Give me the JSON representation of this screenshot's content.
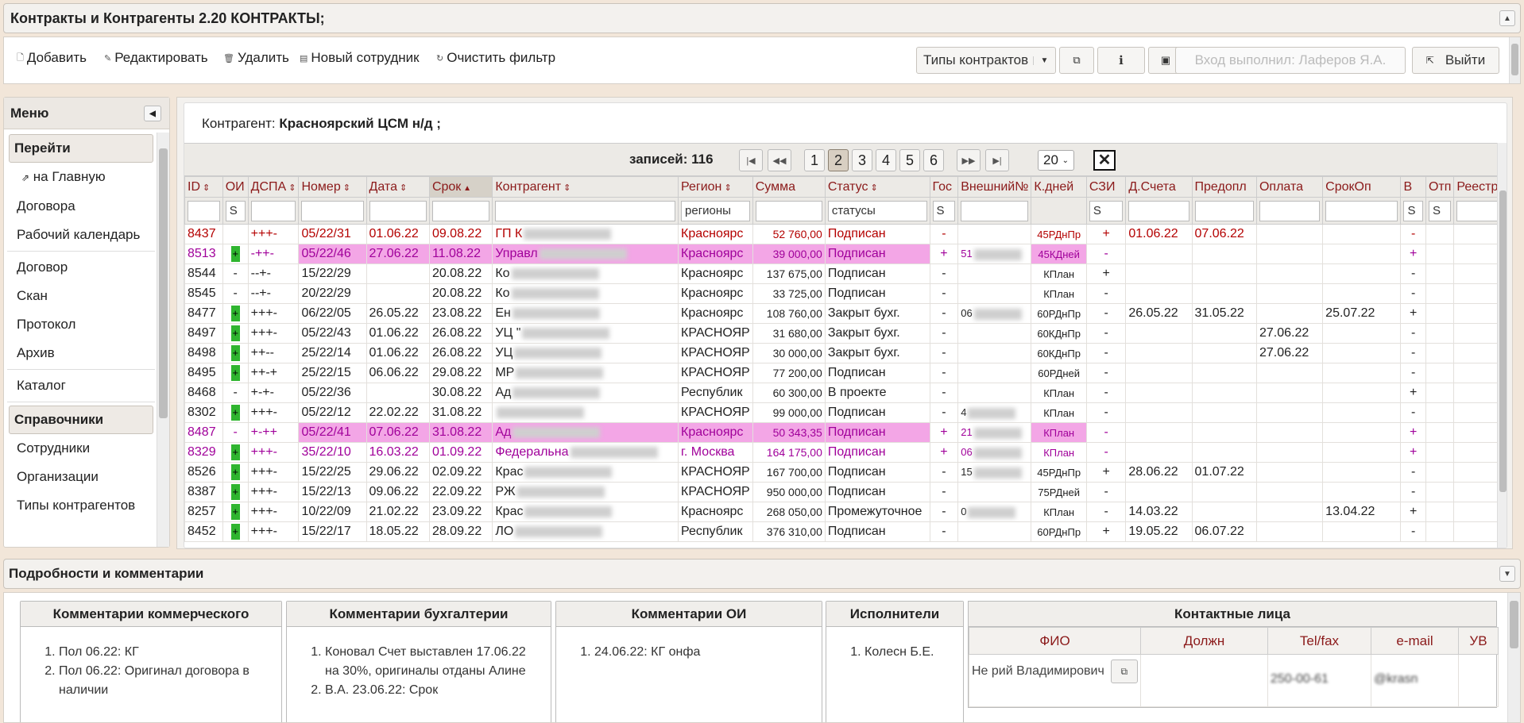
{
  "app": {
    "title": "Контракты и Контрагенты 2.20 КОНТРАКТЫ;"
  },
  "toolbar": {
    "add": "Добавить",
    "edit": "Редактировать",
    "delete": "Удалить",
    "new_employee": "Новый сотрудник",
    "clear_filter": "Очистить фильтр",
    "contract_types": "Типы контрактов",
    "logged_in": "Вход выполнил: Лаферов Я.А.",
    "logout": "Выйти"
  },
  "sidebar": {
    "title": "Меню",
    "go_section": "Перейти",
    "home": "на Главную",
    "items1": [
      "Договора",
      "Рабочий календарь"
    ],
    "items2": [
      "Договор",
      "Скан",
      "Протокол",
      "Архив"
    ],
    "catalog": "Каталог",
    "ref_section": "Справочники",
    "items3": [
      "Сотрудники",
      "Организации",
      "Типы контрагентов"
    ]
  },
  "main": {
    "kontragent_label": "Контрагент:",
    "kontragent_value": "Красноярский ЦСМ н/д ;",
    "pager": {
      "count_label": "записей: 116",
      "pages": [
        "1",
        "2",
        "3",
        "4",
        "5",
        "6"
      ],
      "active": "2",
      "page_size": "20"
    },
    "columns": [
      "ID",
      "ОИ",
      "ДСПА",
      "Номер",
      "Дата",
      "Срок",
      "Контрагент",
      "Регион",
      "Сумма",
      "Статус",
      "Гос",
      "Внешний№",
      "К.дней",
      "СЗИ",
      "Д.Счета",
      "Предопл",
      "Оплата",
      "СрокОп",
      "В",
      "Отп",
      "Реестр"
    ],
    "filters": {
      "oi": "S",
      "region": "регионы",
      "status": "статусы",
      "gos": "S",
      "szi": "S",
      "v": "S",
      "otp": "S"
    },
    "rows": [
      {
        "id": "8437",
        "oi": "",
        "dspa": "+++-",
        "num": "05/22/31",
        "date": "01.06.22",
        "srok": "09.08.22",
        "kontr": "ГП К",
        "region": "Красноярс",
        "sum": "52 760,00",
        "status": "Подписан",
        "gos": "-",
        "ext": "",
        "kdn": "45РДнПр",
        "szi": "+",
        "dschet": "01.06.22",
        "predopl": "07.06.22",
        "opl": "",
        "srokop": "",
        "v": "-",
        "cls": "red"
      },
      {
        "id": "8513",
        "oi": "+",
        "dspa": "-++-",
        "num": "05/22/46",
        "date": "27.06.22",
        "srok": "11.08.22",
        "kontr": "Управл",
        "region": "Красноярс",
        "sum": "39 000,00",
        "status": "Подписан",
        "gos": "+",
        "ext": "51",
        "kdn": "45КДней",
        "szi": "-",
        "dschet": "",
        "predopl": "",
        "opl": "",
        "srokop": "",
        "v": "+",
        "cls": "pink"
      },
      {
        "id": "8544",
        "oi": "-",
        "dspa": "--+-",
        "num": "15/22/29",
        "date": "",
        "srok": "20.08.22",
        "kontr": "Ко",
        "region": "Красноярс",
        "sum": "137 675,00",
        "status": "Подписан",
        "gos": "-",
        "ext": "",
        "kdn": "КПлан",
        "szi": "+",
        "dschet": "",
        "predopl": "",
        "opl": "",
        "srokop": "",
        "v": "-",
        "cls": ""
      },
      {
        "id": "8545",
        "oi": "-",
        "dspa": "--+-",
        "num": "20/22/29",
        "date": "",
        "srok": "20.08.22",
        "kontr": "Ко",
        "region": "Красноярс",
        "sum": "33 725,00",
        "status": "Подписан",
        "gos": "-",
        "ext": "",
        "kdn": "КПлан",
        "szi": "-",
        "dschet": "",
        "predopl": "",
        "opl": "",
        "srokop": "",
        "v": "-",
        "cls": ""
      },
      {
        "id": "8477",
        "oi": "+",
        "dspa": "+++-",
        "num": "06/22/05",
        "date": "26.05.22",
        "srok": "23.08.22",
        "kontr": "Ен",
        "region": "Красноярс",
        "sum": "108 760,00",
        "status": "Закрыт бухг.",
        "gos": "-",
        "ext": "06",
        "kdn": "60РДнПр",
        "szi": "-",
        "dschet": "26.05.22",
        "predopl": "31.05.22",
        "opl": "",
        "srokop": "25.07.22",
        "v": "+",
        "cls": ""
      },
      {
        "id": "8497",
        "oi": "+",
        "dspa": "+++-",
        "num": "05/22/43",
        "date": "01.06.22",
        "srok": "26.08.22",
        "kontr": "УЦ \"",
        "region": "КРАСНОЯР",
        "sum": "31 680,00",
        "status": "Закрыт бухг.",
        "gos": "-",
        "ext": "",
        "kdn": "60КДнПр",
        "szi": "-",
        "dschet": "",
        "predopl": "",
        "opl": "27.06.22",
        "srokop": "",
        "v": "-",
        "cls": ""
      },
      {
        "id": "8498",
        "oi": "+",
        "dspa": "++--",
        "num": "25/22/14",
        "date": "01.06.22",
        "srok": "26.08.22",
        "kontr": "УЦ",
        "region": "КРАСНОЯР",
        "sum": "30 000,00",
        "status": "Закрыт бухг.",
        "gos": "-",
        "ext": "",
        "kdn": "60КДнПр",
        "szi": "-",
        "dschet": "",
        "predopl": "",
        "opl": "27.06.22",
        "srokop": "",
        "v": "-",
        "cls": ""
      },
      {
        "id": "8495",
        "oi": "+",
        "dspa": "++-+",
        "num": "25/22/15",
        "date": "06.06.22",
        "srok": "29.08.22",
        "kontr": "МР",
        "region": "КРАСНОЯР",
        "sum": "77 200,00",
        "status": "Подписан",
        "gos": "-",
        "ext": "",
        "kdn": "60РДней",
        "szi": "-",
        "dschet": "",
        "predopl": "",
        "opl": "",
        "srokop": "",
        "v": "-",
        "cls": ""
      },
      {
        "id": "8468",
        "oi": "-",
        "dspa": "+-+-",
        "num": "05/22/36",
        "date": "",
        "srok": "30.08.22",
        "kontr": "Ад",
        "region": "Республик",
        "sum": "60 300,00",
        "status": "В проекте",
        "gos": "-",
        "ext": "",
        "kdn": "КПлан",
        "szi": "-",
        "dschet": "",
        "predopl": "",
        "opl": "",
        "srokop": "",
        "v": "+",
        "cls": ""
      },
      {
        "id": "8302",
        "oi": "+",
        "dspa": "+++-",
        "num": "05/22/12",
        "date": "22.02.22",
        "srok": "31.08.22",
        "kontr": "",
        "region": "КРАСНОЯР",
        "sum": "99 000,00",
        "status": "Подписан",
        "gos": "-",
        "ext": "4",
        "kdn": "КПлан",
        "szi": "-",
        "dschet": "",
        "predopl": "",
        "opl": "",
        "srokop": "",
        "v": "-",
        "cls": ""
      },
      {
        "id": "8487",
        "oi": "-",
        "dspa": "+-++",
        "num": "05/22/41",
        "date": "07.06.22",
        "srok": "31.08.22",
        "kontr": "Ад",
        "region": "Красноярс",
        "sum": "50 343,35",
        "status": "Подписан",
        "gos": "+",
        "ext": "21",
        "kdn": "КПлан",
        "szi": "-",
        "dschet": "",
        "predopl": "",
        "opl": "",
        "srokop": "",
        "v": "+",
        "cls": "pink"
      },
      {
        "id": "8329",
        "oi": "+",
        "dspa": "+++-",
        "num": "35/22/10",
        "date": "16.03.22",
        "srok": "01.09.22",
        "kontr": "Федеральна",
        "region": "г. Москва",
        "sum": "164 175,00",
        "status": "Подписан",
        "gos": "+",
        "ext": "06",
        "kdn": "КПлан",
        "szi": "-",
        "dschet": "",
        "predopl": "",
        "opl": "",
        "srokop": "",
        "v": "+",
        "cls": "pink2"
      },
      {
        "id": "8526",
        "oi": "+",
        "dspa": "+++-",
        "num": "15/22/25",
        "date": "29.06.22",
        "srok": "02.09.22",
        "kontr": "Крас",
        "region": "КРАСНОЯР",
        "sum": "167 700,00",
        "status": "Подписан",
        "gos": "-",
        "ext": "15",
        "kdn": "45РДнПр",
        "szi": "+",
        "dschet": "28.06.22",
        "predopl": "01.07.22",
        "opl": "",
        "srokop": "",
        "v": "-",
        "cls": ""
      },
      {
        "id": "8387",
        "oi": "+",
        "dspa": "+++-",
        "num": "15/22/13",
        "date": "09.06.22",
        "srok": "22.09.22",
        "kontr": "РЖ",
        "region": "КРАСНОЯР",
        "sum": "950 000,00",
        "status": "Подписан",
        "gos": "-",
        "ext": "",
        "kdn": "75РДней",
        "szi": "-",
        "dschet": "",
        "predopl": "",
        "opl": "",
        "srokop": "",
        "v": "-",
        "cls": ""
      },
      {
        "id": "8257",
        "oi": "+",
        "dspa": "+++-",
        "num": "10/22/09",
        "date": "21.02.22",
        "srok": "23.09.22",
        "kontr": "Крас",
        "region": "Красноярс",
        "sum": "268 050,00",
        "status": "Промежуточное",
        "gos": "-",
        "ext": "0",
        "kdn": "КПлан",
        "szi": "-",
        "dschet": "14.03.22",
        "predopl": "",
        "opl": "",
        "srokop": "13.04.22",
        "v": "+",
        "cls": ""
      },
      {
        "id": "8452",
        "oi": "+",
        "dspa": "+++-",
        "num": "15/22/17",
        "date": "18.05.22",
        "srok": "28.09.22",
        "kontr": "ЛО",
        "region": "Республик",
        "sum": "376 310,00",
        "status": "Подписан",
        "gos": "-",
        "ext": "",
        "kdn": "60РДнПр",
        "szi": "+",
        "dschet": "19.05.22",
        "predopl": "06.07.22",
        "opl": "",
        "srokop": "",
        "v": "-",
        "cls": ""
      }
    ]
  },
  "details": {
    "title": "Подробности и комментарии",
    "commerce_title": "Комментарии коммерческого",
    "commerce": [
      "Пол 06.22: КГ",
      "Пол 06.22: Оригинал договора в наличии"
    ],
    "buh_title": "Комментарии бухгалтерии",
    "buh": [
      "Коновал Счет выставлен 17.06.22 на 30%, оригиналы отданы Алине",
      "В.А. 23.06.22: Срок"
    ],
    "oi_title": "Комментарии ОИ",
    "oi": [
      "24.06.22: КГ онфа"
    ],
    "exec_title": "Исполнители",
    "exec": [
      "Колесн Б.Е."
    ],
    "contacts_title": "Контактные лица",
    "contact_cols": [
      "ФИО",
      "Должн",
      "Tel/fax",
      "e-mail",
      "УВ"
    ],
    "contact_fio": "Не рий Владимирович",
    "contact_tel": "250-00-61",
    "contact_email": "@krasn"
  }
}
